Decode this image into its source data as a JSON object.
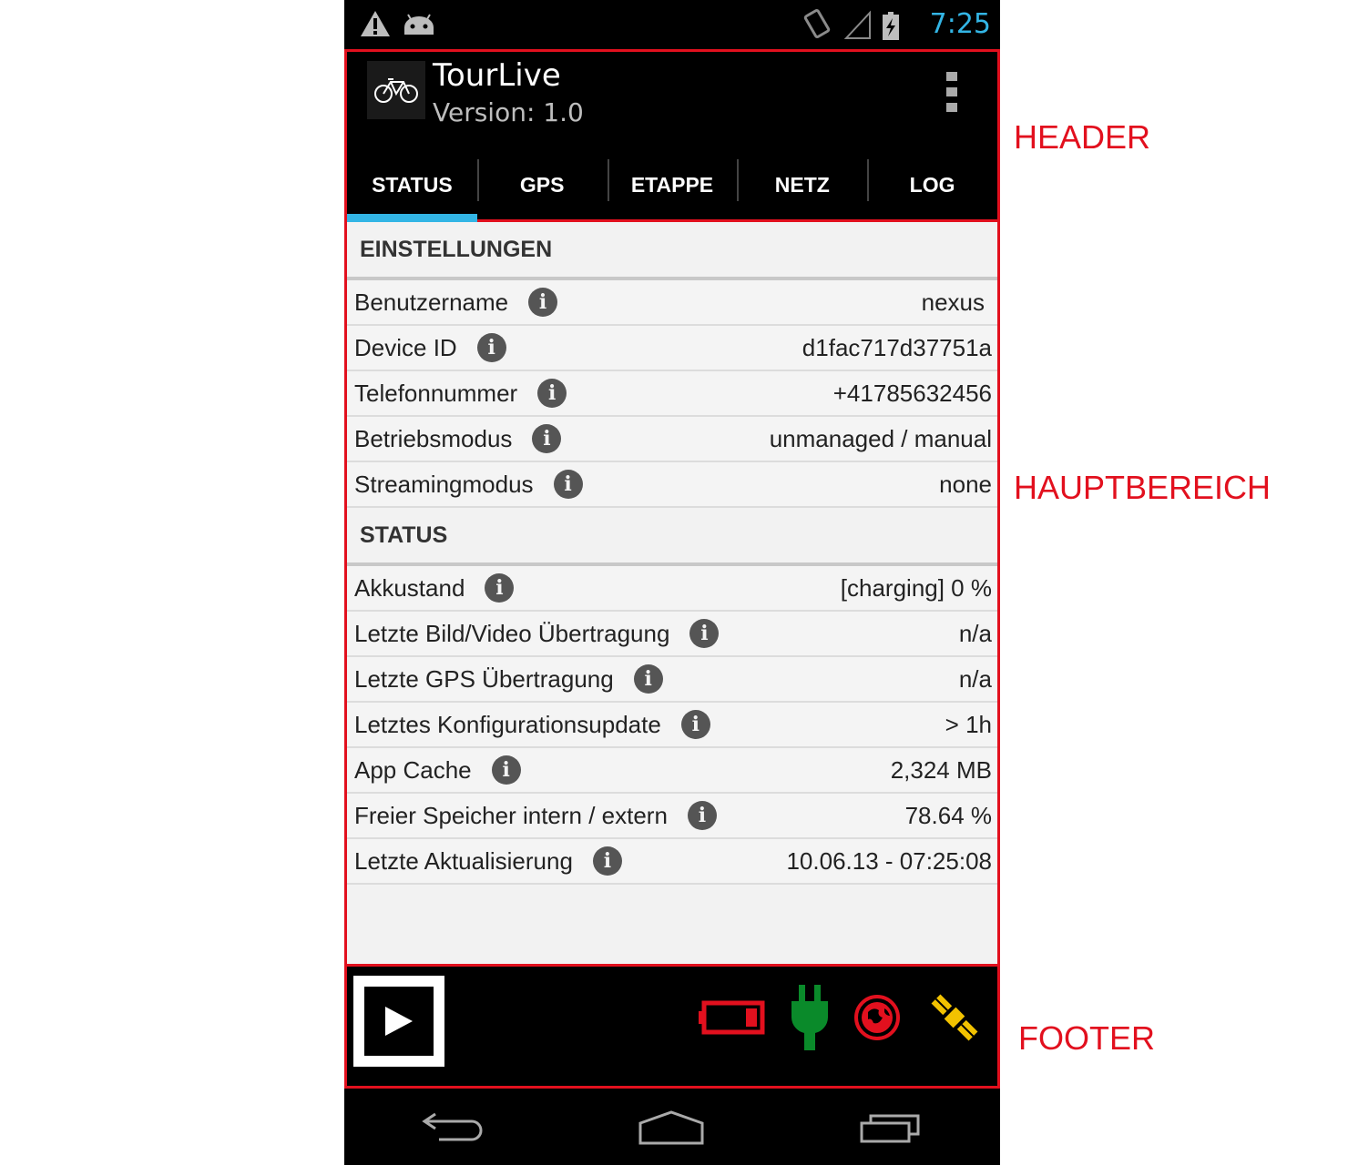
{
  "status_bar": {
    "time": "7:25"
  },
  "header": {
    "app_title": "TourLive",
    "app_version": "Version: 1.0",
    "tabs": [
      {
        "label": "STATUS",
        "active": true
      },
      {
        "label": "GPS",
        "active": false
      },
      {
        "label": "ETAPPE",
        "active": false
      },
      {
        "label": "NETZ",
        "active": false
      },
      {
        "label": "LOG",
        "active": false
      }
    ]
  },
  "main": {
    "settings": {
      "title": "EINSTELLUNGEN",
      "rows": [
        {
          "label": "Benutzername",
          "value": "nexus"
        },
        {
          "label": "Device ID",
          "value": "d1fac717d37751a"
        },
        {
          "label": "Telefonnummer",
          "value": "+41785632456"
        },
        {
          "label": "Betriebsmodus",
          "value": "unmanaged / manual"
        },
        {
          "label": "Streamingmodus",
          "value": "none"
        }
      ]
    },
    "status": {
      "title": "STATUS",
      "rows": [
        {
          "label": "Akkustand",
          "value": "[charging] 0 %"
        },
        {
          "label": "Letzte Bild/Video Übertragung",
          "value": "n/a"
        },
        {
          "label": "Letzte GPS Übertragung",
          "value": "n/a"
        },
        {
          "label": "Letztes Konfigurationsupdate",
          "value": "> 1h"
        },
        {
          "label": "App Cache",
          "value": "2,324 MB"
        },
        {
          "label": "Freier Speicher intern / extern",
          "value": "78.64 %"
        },
        {
          "label": "Letzte Aktualisierung",
          "value": "10.06.13 - 07:25:08"
        }
      ]
    },
    "info_icon_glyph": "i"
  },
  "footer": {
    "icons": [
      "battery-icon",
      "plug-icon",
      "globe-icon",
      "satellite-icon"
    ],
    "colors": {
      "battery": "#e2101e",
      "plug": "#0a8a2a",
      "globe": "#e2101e",
      "satellite": "#f2c200"
    }
  },
  "annotations": {
    "header": "HEADER",
    "main": "HAUPTBEREICH",
    "footer": "FOOTER"
  },
  "colors": {
    "accent": "#33b5e5",
    "annotation_red": "#e2101e"
  }
}
